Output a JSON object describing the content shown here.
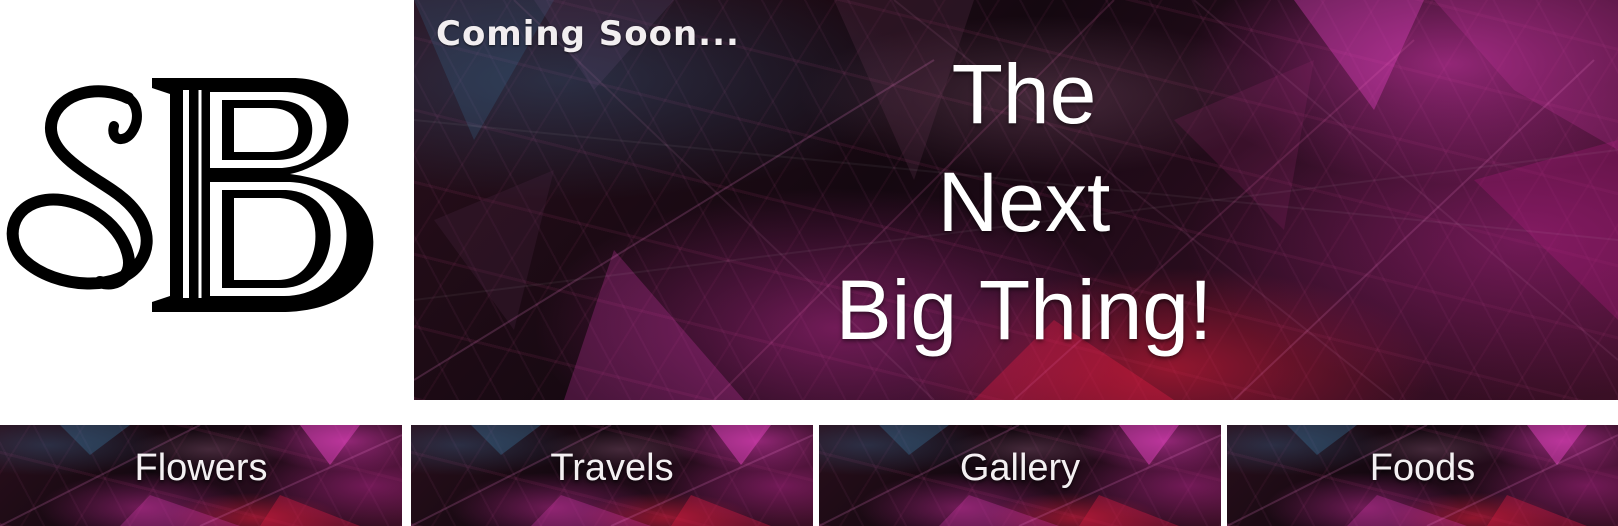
{
  "logo": {
    "monogram": "SB",
    "icon": "sb-monogram-logo-icon",
    "color": "#000000"
  },
  "hero": {
    "tagline": "Coming Soon...",
    "headline": [
      "The",
      "Next",
      "Big Thing!"
    ],
    "colors": {
      "accent_magenta": "#e83cbe",
      "accent_red": "#e61e3c",
      "accent_teal": "#3c6e96",
      "base_dark": "#1b0a12"
    }
  },
  "nav": {
    "items": [
      {
        "label": "Flowers"
      },
      {
        "label": "Travels"
      },
      {
        "label": "Gallery"
      },
      {
        "label": "Foods"
      }
    ]
  }
}
